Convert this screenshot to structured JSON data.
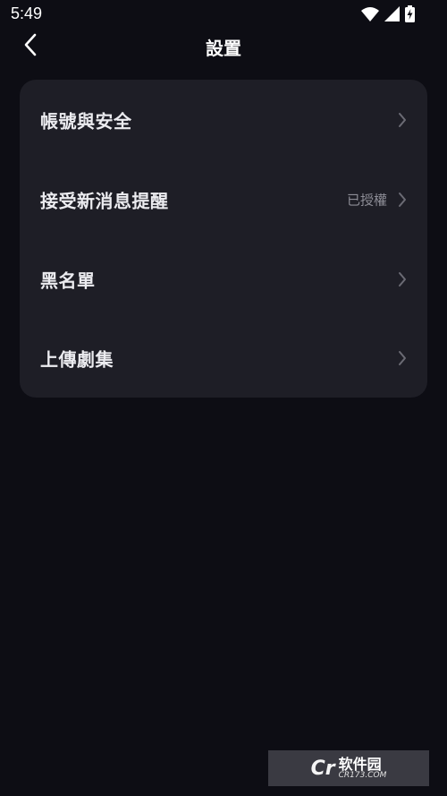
{
  "status_bar": {
    "time": "5:49",
    "icons": [
      "wifi-icon",
      "signal-icon",
      "battery-charging-icon"
    ]
  },
  "header": {
    "title": "設置",
    "back_icon": "chevron-left-icon"
  },
  "settings": {
    "items": [
      {
        "label": "帳號與安全",
        "value": ""
      },
      {
        "label": "接受新消息提醒",
        "value": "已授權"
      },
      {
        "label": "黑名單",
        "value": ""
      },
      {
        "label": "上傳劇集",
        "value": ""
      }
    ]
  },
  "watermark": {
    "logo_text": "Cr",
    "cn_text": "软件园",
    "en_text": "CR173.COM"
  },
  "colors": {
    "background": "#0d0d14",
    "card": "#1e1e26",
    "label": "#ececf0",
    "secondary": "#8d8d96",
    "chevron": "#6b6b74"
  }
}
